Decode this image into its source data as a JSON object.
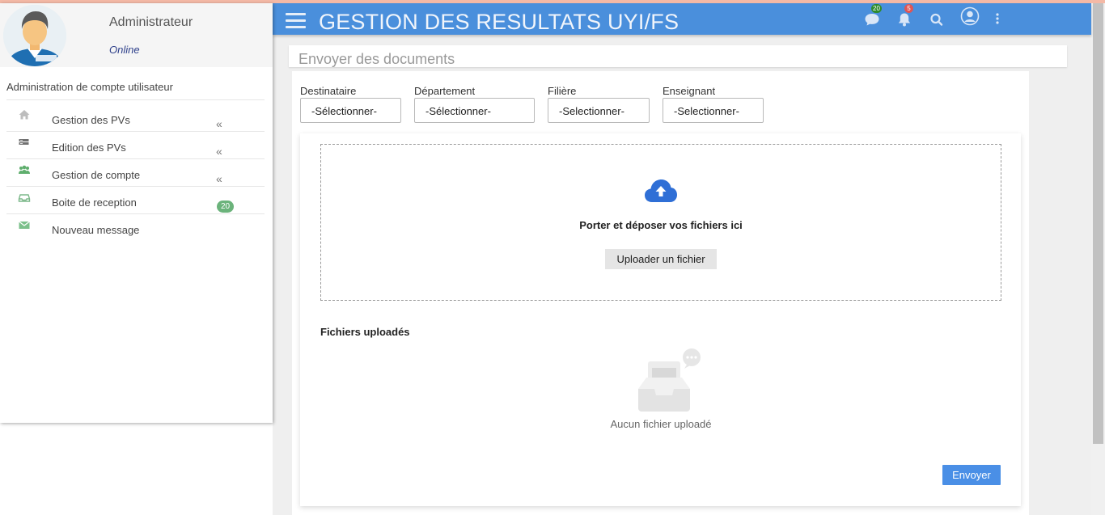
{
  "colors": {
    "navbar": "#4a8fdc",
    "accent_button": "#4a8fe6",
    "badge_green": "#2e8b2e",
    "badge_red": "#e05555",
    "menu_icon_green": "#6bb37b"
  },
  "profile": {
    "name": "Administrateur",
    "status": "Online"
  },
  "sidebar": {
    "section_title": "Administration de compte utilisateur",
    "items": [
      {
        "label": "Gestion des PVs",
        "icon": "home-icon",
        "arrow": "«"
      },
      {
        "label": "Edition des PVs",
        "icon": "server-icon",
        "arrow": "«"
      },
      {
        "label": "Gestion de compte",
        "icon": "users-icon",
        "arrow": "«"
      },
      {
        "label": "Boite de reception",
        "icon": "inbox-icon",
        "badge": "20"
      },
      {
        "label": "Nouveau message",
        "icon": "envelope-icon"
      }
    ]
  },
  "navbar": {
    "title": "GESTION DES RESULTATS UYI/FS",
    "messages_badge": "20",
    "notifications_badge": "5"
  },
  "page": {
    "title": "Envoyer des documents"
  },
  "filters": [
    {
      "label": "Destinataire",
      "value": "-Sélectionner-"
    },
    {
      "label": "Département",
      "value": "-Sélectionner-"
    },
    {
      "label": "Filière",
      "value": "-Selectionner-"
    },
    {
      "label": "Enseignant",
      "value": "-Selectionner-"
    }
  ],
  "upload": {
    "drop_text": "Porter et déposer vos fichiers ici",
    "button_label": "Uploader un fichier",
    "files_title": "Fichiers uploadés",
    "empty_text": "Aucun fichier uploadé",
    "send_label": "Envoyer"
  }
}
